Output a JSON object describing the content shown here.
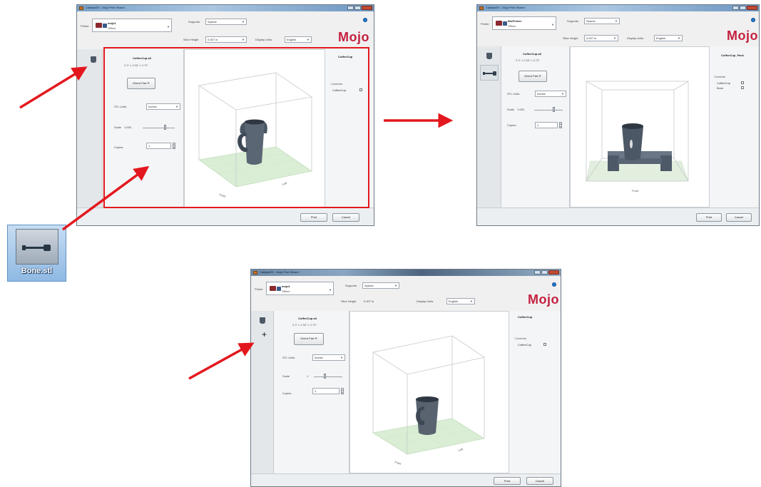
{
  "dialog_a": {
    "window_title": "CatalystEX - Mojo Print Wizard",
    "printer_label": "Printer",
    "printer_name": "mojo1",
    "printer_status": "Offline",
    "supports_label": "Supports",
    "supports_value": "Sparse",
    "slice_height_label": "Slice Height",
    "slice_height_value": "0.007 in",
    "display_units_label": "Display Units",
    "display_units_value": "English",
    "logo": "Mojo",
    "part_name": "CoffeeCup.stl",
    "part_dims": "3.3\" x 2.58\" x 3.75\"",
    "orient_part_button": "Orient Part",
    "stl_units_label": "STL Units",
    "stl_units_value": "Inches",
    "scale_label": "Scale",
    "scale_value": "1.000",
    "copies_label": "Copies",
    "copies_value": "1",
    "axis_front": "Front",
    "axis_left": "Left",
    "right_title": "CoffeeCup",
    "contents_label": "Contents",
    "contents_item": "CoffeeCup",
    "print_button": "Print",
    "cancel_button": "Cancel"
  },
  "dialog_b": {
    "window_title": "CatalystEX - Mojo Print Wizard",
    "printer_label": "Printer",
    "printer_name": "BioPrinter",
    "printer_status": "Offline",
    "supports_label": "Supports",
    "supports_value": "Sparse",
    "slice_height_label": "Slice Height",
    "slice_height_value": "0.007 in",
    "display_units_label": "Display Units",
    "display_units_value": "English",
    "logo": "Mojo",
    "part_name": "CoffeeCup.stl",
    "part_dims": "3.3\" x 2.58\" x 3.75\"",
    "orient_part_button": "Orient Part",
    "stl_units_label": "STL Units",
    "stl_units_value": "Inches",
    "scale_label": "Scale",
    "scale_value": "1.000",
    "copies_label": "Copies",
    "copies_value": "1",
    "axis_front": "Front",
    "right_title": "CoffeeCup_Pack",
    "contents_label": "Contents",
    "contents_items": [
      "CoffeeCup",
      "Bone"
    ],
    "print_button": "Print",
    "cancel_button": "Cancel"
  },
  "dialog_c": {
    "window_title": "CatalystEX - Mojo Print Wizard",
    "printer_label": "Printer",
    "printer_name": "mojo1",
    "printer_status": "Offline",
    "supports_label": "Supports",
    "supports_value": "Sparse",
    "slice_height_label": "Slice Height",
    "slice_height_value": "0.007 in",
    "display_units_label": "Display Units",
    "display_units_value": "English",
    "logo": "Mojo",
    "part_name": "CoffeeCup.stl",
    "part_dims": "3.3\" x 2.58\" x 3.75\"",
    "orient_part_button": "Orient Part",
    "stl_units_label": "STL Units",
    "stl_units_value": "Inches",
    "scale_label": "Scale",
    "scale_value": "1",
    "copies_label": "Copies",
    "copies_value": "1",
    "axis_front": "Front",
    "axis_left": "Left",
    "strip_add_glyph": "+",
    "right_title": "CoffeeCup",
    "contents_label": "Contents",
    "contents_item": "CoffeeCup",
    "print_button": "Print",
    "cancel_button": "Cancel"
  },
  "dropped_file_icon": {
    "caption": "Bone.stl",
    "icon": "bone-part-icon"
  },
  "colors": {
    "annotation_red": "#e3181e",
    "logo_red": "#c4203f",
    "cup_gray": "#4a5563",
    "build_plate_green": "#cfe8c9"
  }
}
